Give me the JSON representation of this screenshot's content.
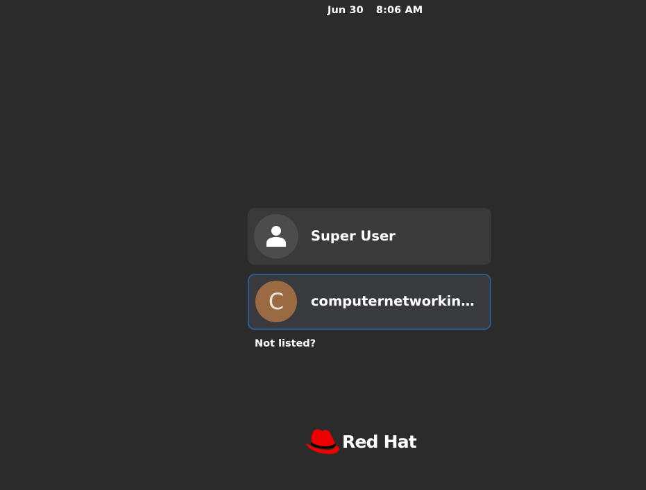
{
  "topbar": {
    "date": "Jun 30",
    "time": "8:06 AM"
  },
  "users": [
    {
      "name": "Super User",
      "avatar": {
        "type": "icon",
        "icon": "person-icon",
        "bg": "#4c4c4c"
      }
    },
    {
      "name": "computernetworkingno…",
      "avatar": {
        "type": "initial",
        "initial": "C",
        "bg": "#9a6a43"
      },
      "selected": true
    }
  ],
  "login": {
    "not_listed_label": "Not listed?"
  },
  "branding": {
    "logo_text": "Red Hat",
    "logo_icon": "red-hat-fedora-icon",
    "brand_color": "#ee0000"
  },
  "colors": {
    "background": "#2b2b2b",
    "row_bg": "#3a3a3a",
    "selected_border": "#2f5a8f"
  }
}
